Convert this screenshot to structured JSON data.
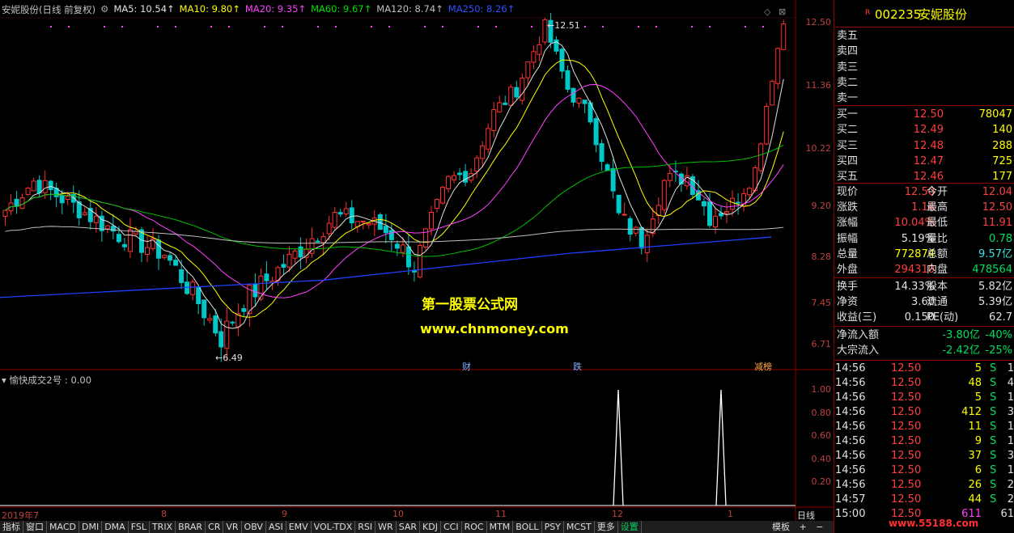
{
  "stock": {
    "flag": "R",
    "code": "002235",
    "name": "安妮股份"
  },
  "header": {
    "title": "安妮股份(日线 前复权)",
    "ma": [
      {
        "label": "MA5: 10.54↑",
        "color": "#e0e0e0"
      },
      {
        "label": "MA10: 9.80↑",
        "color": "#ffff00"
      },
      {
        "label": "MA20: 9.35↑",
        "color": "#ff40ff"
      },
      {
        "label": "MA60: 9.67↑",
        "color": "#00e000"
      },
      {
        "label": "MA120: 8.74↑",
        "color": "#c0c0c0"
      },
      {
        "label": "MA250: 8.26↑",
        "color": "#3050ff"
      }
    ]
  },
  "price_axis": [
    "12.50",
    "11.36",
    "10.22",
    "9.20",
    "8.28",
    "7.45",
    "6.71"
  ],
  "indicator_axis": [
    "1.00",
    "0.80",
    "0.60",
    "0.40",
    "0.20"
  ],
  "indicator_header": "愉快成交2号 : 0.00",
  "annotations": {
    "high": "12.51",
    "low": "6.49"
  },
  "watermark": {
    "line1": "第一股票公式网",
    "line2": "www.chnmoney.com"
  },
  "events": [
    "财",
    "跌",
    "减榜"
  ],
  "x_axis": [
    "2019年7",
    "8",
    "9",
    "10",
    "11",
    "12",
    "1"
  ],
  "period": "日线",
  "tabs": [
    "指标",
    "窗口",
    "MACD",
    "DMI",
    "DMA",
    "FSL",
    "TRIX",
    "BRAR",
    "CR",
    "VR",
    "OBV",
    "ASI",
    "EMV",
    "VOL-TDX",
    "RSI",
    "WR",
    "SAR",
    "KDJ",
    "CCI",
    "ROC",
    "MTM",
    "BOLL",
    "PSY",
    "MCST",
    "更多",
    "设置"
  ],
  "tab_right": "模板",
  "order_book": {
    "sell": [
      {
        "label": "卖五"
      },
      {
        "label": "卖四"
      },
      {
        "label": "卖三"
      },
      {
        "label": "卖二"
      },
      {
        "label": "卖一"
      }
    ],
    "buy": [
      {
        "label": "买一",
        "price": "12.50",
        "vol": "78047"
      },
      {
        "label": "买二",
        "price": "12.49",
        "vol": "140"
      },
      {
        "label": "买三",
        "price": "12.48",
        "vol": "288"
      },
      {
        "label": "买四",
        "price": "12.47",
        "vol": "725"
      },
      {
        "label": "买五",
        "price": "12.46",
        "vol": "177"
      }
    ]
  },
  "quote": [
    {
      "l1": "现价",
      "v1": "12.50",
      "c1": "red",
      "l2": "今开",
      "v2": "12.04",
      "c2": "red"
    },
    {
      "l1": "涨跌",
      "v1": "1.14",
      "c1": "red",
      "l2": "最高",
      "v2": "12.50",
      "c2": "red"
    },
    {
      "l1": "涨幅",
      "v1": "10.04%",
      "c1": "red",
      "l2": "最低",
      "v2": "11.91",
      "c2": "red"
    },
    {
      "l1": "振幅",
      "v1": "5.19%",
      "c1": "wht",
      "l2": "量比",
      "v2": "0.78",
      "c2": "grn"
    },
    {
      "l1": "总量",
      "v1": "772874",
      "c1": "yel",
      "l2": "总额",
      "v2": "9.57亿",
      "c2": "cyn"
    },
    {
      "l1": "外盘",
      "v1": "294310",
      "c1": "red",
      "l2": "内盘",
      "v2": "478564",
      "c2": "grn"
    }
  ],
  "fundamentals": [
    {
      "l1": "换手",
      "v1": "14.33%",
      "l2": "股本",
      "v2": "5.82亿"
    },
    {
      "l1": "净资",
      "v1": "3.60",
      "l2": "流通",
      "v2": "5.39亿"
    },
    {
      "l1": "收益(三)",
      "v1": "0.150",
      "l2": "PE(动)",
      "v2": "62.7"
    }
  ],
  "flows": [
    {
      "label": "净流入额",
      "v1": "-3.80亿",
      "v2": "-40%"
    },
    {
      "label": "大宗流入",
      "v1": "-2.42亿",
      "v2": "-25%"
    }
  ],
  "ticks": [
    {
      "t": "14:56",
      "p": "12.50",
      "v": "5",
      "s": "S",
      "n": "1"
    },
    {
      "t": "14:56",
      "p": "12.50",
      "v": "48",
      "s": "S",
      "n": "4"
    },
    {
      "t": "14:56",
      "p": "12.50",
      "v": "5",
      "s": "S",
      "n": "1"
    },
    {
      "t": "14:56",
      "p": "12.50",
      "v": "412",
      "s": "S",
      "n": "3"
    },
    {
      "t": "14:56",
      "p": "12.50",
      "v": "11",
      "s": "S",
      "n": "1"
    },
    {
      "t": "14:56",
      "p": "12.50",
      "v": "9",
      "s": "S",
      "n": "1"
    },
    {
      "t": "14:56",
      "p": "12.50",
      "v": "37",
      "s": "S",
      "n": "3"
    },
    {
      "t": "14:56",
      "p": "12.50",
      "v": "6",
      "s": "S",
      "n": "1"
    },
    {
      "t": "14:56",
      "p": "12.50",
      "v": "26",
      "s": "S",
      "n": "2"
    },
    {
      "t": "14:57",
      "p": "12.50",
      "v": "44",
      "s": "S",
      "n": "2"
    },
    {
      "t": "15:00",
      "p": "12.50",
      "v": "611",
      "s": "",
      "n": "61"
    }
  ],
  "site_stamp": "www.55188.com"
}
